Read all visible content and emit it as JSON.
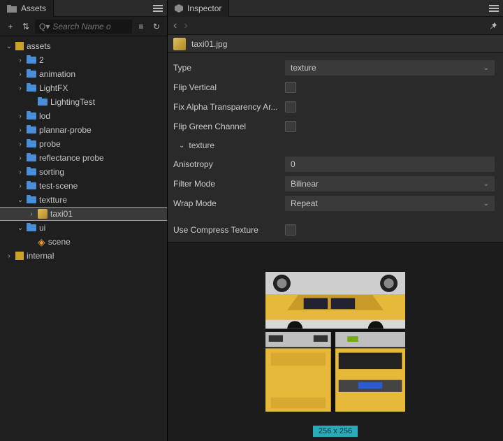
{
  "assets_panel": {
    "title": "Assets",
    "search_placeholder": "Search Name o"
  },
  "tree": [
    {
      "depth": 0,
      "expand": "down",
      "icon": "pkg",
      "label": "assets"
    },
    {
      "depth": 1,
      "expand": "right",
      "icon": "folder",
      "label": "2"
    },
    {
      "depth": 1,
      "expand": "right",
      "icon": "folder",
      "label": "animation"
    },
    {
      "depth": 1,
      "expand": "right",
      "icon": "folder",
      "label": "LightFX"
    },
    {
      "depth": 2,
      "expand": "none",
      "icon": "folder",
      "label": "LightingTest"
    },
    {
      "depth": 1,
      "expand": "right",
      "icon": "folder",
      "label": "lod"
    },
    {
      "depth": 1,
      "expand": "right",
      "icon": "folder",
      "label": "plannar-probe"
    },
    {
      "depth": 1,
      "expand": "right",
      "icon": "folder",
      "label": "probe"
    },
    {
      "depth": 1,
      "expand": "right",
      "icon": "folder",
      "label": "reflectance probe"
    },
    {
      "depth": 1,
      "expand": "right",
      "icon": "folder",
      "label": "sorting"
    },
    {
      "depth": 1,
      "expand": "right",
      "icon": "folder",
      "label": "test-scene"
    },
    {
      "depth": 1,
      "expand": "down",
      "icon": "folder",
      "label": "textture"
    },
    {
      "depth": 2,
      "expand": "right",
      "icon": "img",
      "label": "taxi01",
      "selected": true
    },
    {
      "depth": 1,
      "expand": "down",
      "icon": "folder",
      "label": "ui"
    },
    {
      "depth": 2,
      "expand": "none",
      "icon": "fire",
      "label": "scene"
    },
    {
      "depth": 0,
      "expand": "right",
      "icon": "pkg",
      "label": "internal"
    }
  ],
  "inspector": {
    "title": "Inspector",
    "file_name": "taxi01.jpg",
    "props": {
      "type_label": "Type",
      "type_value": "texture",
      "flip_v_label": "Flip Vertical",
      "fix_alpha_label": "Fix Alpha Transparency Ar...",
      "flip_g_label": "Flip Green Channel",
      "section_label": "texture",
      "aniso_label": "Anisotropy",
      "aniso_value": "0",
      "filter_label": "Filter Mode",
      "filter_value": "Bilinear",
      "wrap_label": "Wrap Mode",
      "wrap_value": "Repeat",
      "compress_label": "Use Compress Texture"
    },
    "size_badge": "256 x 256"
  }
}
